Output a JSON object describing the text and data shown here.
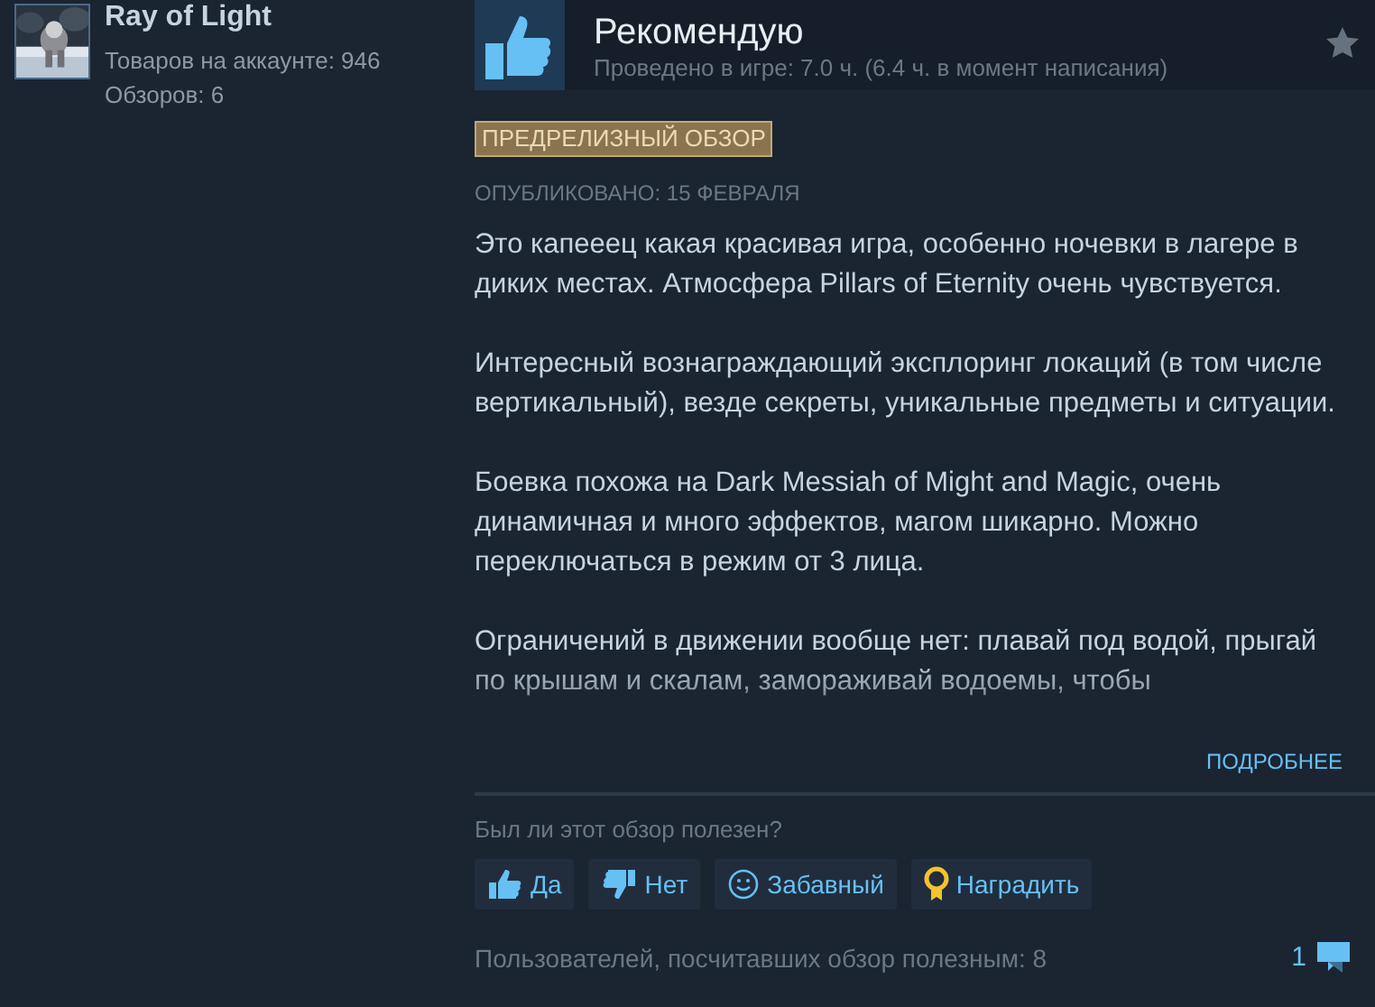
{
  "reviewer": {
    "name": "Ray of Light",
    "products": "Товаров на аккаунте: 946",
    "reviews": "Обзоров: 6"
  },
  "review": {
    "verdict": "Рекомендую",
    "recommended": true,
    "playtime": "Проведено в игре: 7.0 ч. (6.4 ч. в момент написания)",
    "badge": "ПРЕДРЕЛИЗНЫЙ ОБЗОР",
    "published": "ОПУБЛИКОВАНО: 15 ФЕВРАЛЯ",
    "paragraphs": [
      "Это капееец какая красивая игра, особенно ночевки в лагере в диких местах. Атмосфера Pillars of Eternity очень чувствуется.",
      "Интересный вознаграждающий эксплоринг локаций (в том числе вертикальный), везде секреты, уникальные предметы и ситуации.",
      "Боевка похожа на Dark Messiah of Might and Magic, очень динамичная и много эффектов, магом шикарно. Можно переключаться в режим от 3 лица.",
      "Ограничений в движении вообще нет: плавай под водой, прыгай по крышам и скалам, замораживай водоемы, чтобы"
    ],
    "read_more": "ПОДРОБНЕЕ"
  },
  "helpful": {
    "question": "Был ли этот обзор полезен?",
    "buttons": [
      {
        "label": "Да",
        "kind": "yes"
      },
      {
        "label": "Нет",
        "kind": "no"
      },
      {
        "label": "Забавный",
        "kind": "funny"
      },
      {
        "label": "Наградить",
        "kind": "award"
      }
    ],
    "count": "Пользователей, посчитавших обзор полезным: 8",
    "comments": "1"
  }
}
